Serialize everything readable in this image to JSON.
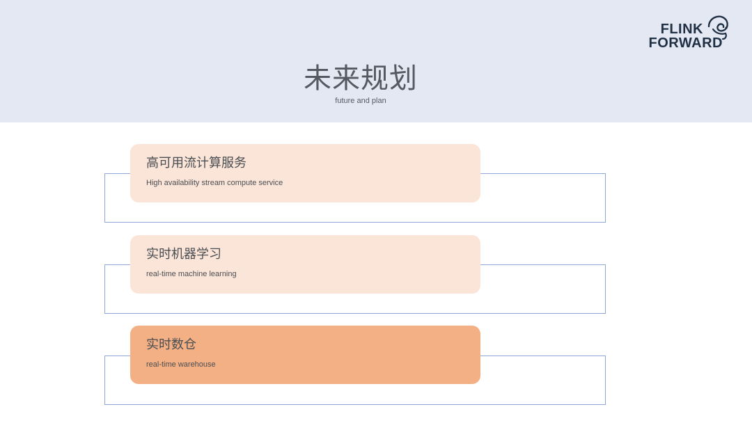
{
  "header": {
    "title": "未来规划",
    "subtitle": "future and plan"
  },
  "logo": {
    "line1": "FLINK",
    "line2": "FORWARD",
    "icon": "squirrel-icon",
    "color": "#1f2f44"
  },
  "items": [
    {
      "title": "高可用流计算服务",
      "subtitle": "High availability stream compute service",
      "color": "#fae5d8"
    },
    {
      "title": "实时机器学习",
      "subtitle": "real-time machine learning",
      "color": "#fae5d8"
    },
    {
      "title": "实时数仓",
      "subtitle": "real-time warehouse",
      "color": "#f3b084"
    }
  ],
  "colors": {
    "header_background": "#e4e8f2",
    "frame_border": "#8fa6d8",
    "text": "#4a4d52"
  }
}
